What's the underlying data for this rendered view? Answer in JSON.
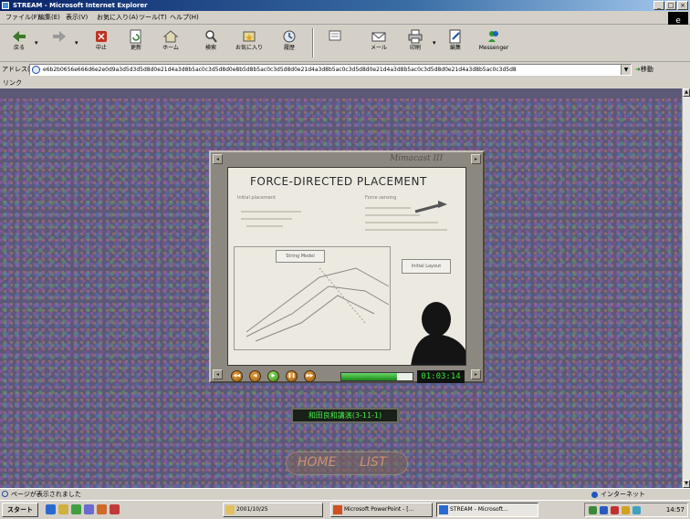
{
  "window": {
    "title": "STREAM - Microsoft Internet Explorer",
    "controls": [
      "_",
      "□",
      "×"
    ]
  },
  "menu": {
    "items": [
      "ファイル(F)",
      "編集(E)",
      "表示(V)",
      "お気に入り(A)",
      "ツール(T)",
      "ヘルプ(H)"
    ]
  },
  "toolbar": {
    "buttons": [
      {
        "label": "戻る",
        "icon": "back-arrow-icon"
      },
      {
        "label": "",
        "icon": "forward-arrow-icon"
      },
      {
        "label": "中止",
        "icon": "stop-icon"
      },
      {
        "label": "更新",
        "icon": "refresh-icon"
      },
      {
        "label": "ホーム",
        "icon": "home-icon"
      },
      {
        "label": "検索",
        "icon": "search-icon"
      },
      {
        "label": "お気に入り",
        "icon": "favorites-icon"
      },
      {
        "label": "履歴",
        "icon": "history-icon"
      },
      {
        "label": "",
        "icon": "channel-icon"
      },
      {
        "label": "メール",
        "icon": "mail-icon"
      },
      {
        "label": "印刷",
        "icon": "print-icon"
      },
      {
        "label": "編集",
        "icon": "edit-icon"
      },
      {
        "label": "Messenger",
        "icon": "messenger-icon"
      }
    ]
  },
  "address": {
    "label": "アドレス(D)",
    "url": "e6b2b0656e666d6e2e0d9a3d5d3d5d8d0e21d4a3d8b5ac0c3d5d8d0e8b5d8b5ac0c3d5d8d0e21d4a3d8b5ac0c3d5d8d0e21d4a3d8b5ac0c3d5d8d0e21d4a3d8b5ac0c3d5d8",
    "go_label": "移動"
  },
  "links": {
    "label": "リンク"
  },
  "player": {
    "logo_text": "Mimacast III",
    "slide": {
      "title": "FORCE-DIRECTED PLACEMENT",
      "left_note": "Initial placement",
      "right_note": "Force sensing",
      "box_label": "String Model",
      "side_box": "Initial Layout"
    },
    "controls": [
      "rewind",
      "back",
      "play",
      "pause",
      "forward"
    ],
    "progress": 0.78,
    "timecode": "01:03:14"
  },
  "caption": "和田良和講演(3-11-1)",
  "nav": {
    "home": "HOME",
    "list": "LIST"
  },
  "status": {
    "text": "ページが表示されました",
    "zone": "インターネット"
  },
  "taskbar": {
    "start": "スタート",
    "tasks": [
      {
        "label": "2001/10/25"
      },
      {
        "label": "Microsoft PowerPoint - [..."
      },
      {
        "label": "STREAM - Microsoft..."
      }
    ],
    "clock": "14:57"
  },
  "colors": {
    "title_active": "#0a246a",
    "timecode_green": "#38e038",
    "nav_text": "#e6a078",
    "content_bg": "#5c5878"
  }
}
